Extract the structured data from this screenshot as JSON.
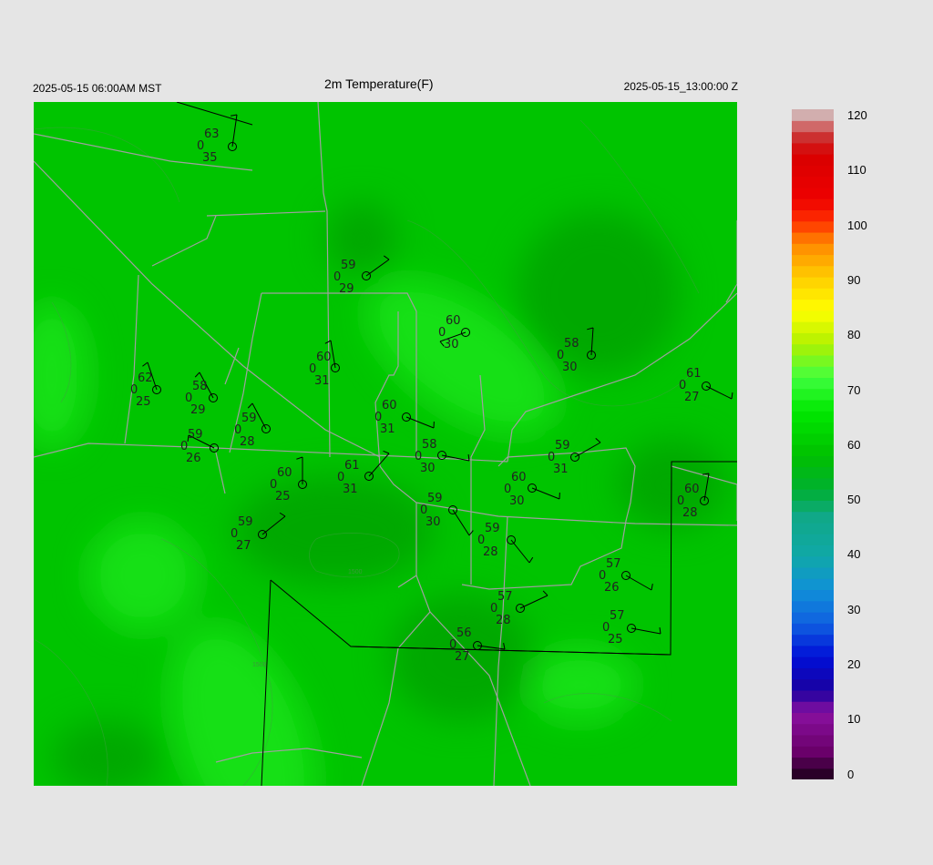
{
  "header": {
    "local_time": "2025-05-15 06:00AM MST",
    "title": "2m Temperature(F)",
    "utc_time": "2025-05-15_13:00:00 Z"
  },
  "colorbar": {
    "labels": [
      "120",
      "110",
      "100",
      "90",
      "80",
      "70",
      "60",
      "50",
      "40",
      "30",
      "20",
      "10",
      "0"
    ],
    "min": 0,
    "max": 120,
    "stops": [
      {
        "v": 0,
        "c": "#1a0018"
      },
      {
        "v": 5,
        "c": "#6a006a"
      },
      {
        "v": 12,
        "c": "#8a10a0"
      },
      {
        "v": 16,
        "c": "#1a00a0"
      },
      {
        "v": 22,
        "c": "#0010d8"
      },
      {
        "v": 28,
        "c": "#1060e0"
      },
      {
        "v": 34,
        "c": "#1090d8"
      },
      {
        "v": 40,
        "c": "#10a8a8"
      },
      {
        "v": 47,
        "c": "#10a888"
      },
      {
        "v": 52,
        "c": "#00b030"
      },
      {
        "v": 58,
        "c": "#00c000"
      },
      {
        "v": 66,
        "c": "#00e800"
      },
      {
        "v": 72,
        "c": "#40ff40"
      },
      {
        "v": 78,
        "c": "#b0f000"
      },
      {
        "v": 84,
        "c": "#ffff00"
      },
      {
        "v": 90,
        "c": "#ffcc00"
      },
      {
        "v": 96,
        "c": "#ff8800"
      },
      {
        "v": 100,
        "c": "#ff3000"
      },
      {
        "v": 104,
        "c": "#ee0000"
      },
      {
        "v": 112,
        "c": "#d80000"
      },
      {
        "v": 116,
        "c": "#c84040"
      },
      {
        "v": 118,
        "c": "#d89090"
      },
      {
        "v": 120,
        "c": "#cccccc"
      }
    ]
  },
  "map": {
    "fill_color": "#00c400",
    "light_color": "#12e012",
    "dark_color": "#00a800",
    "road_color": "#a0a0a0",
    "border_color": "#000000",
    "contour_labels": [
      "1500",
      "1500"
    ]
  },
  "stations": [
    {
      "temp": "63",
      "dew": "35",
      "mid": "0"
    },
    {
      "temp": "59",
      "dew": "29",
      "mid": "0"
    },
    {
      "temp": "60",
      "dew": "30",
      "mid": "0"
    },
    {
      "temp": "58",
      "dew": "30",
      "mid": "0"
    },
    {
      "temp": "60",
      "dew": "31",
      "mid": "0"
    },
    {
      "temp": "62",
      "dew": "25",
      "mid": "0"
    },
    {
      "temp": "58",
      "dew": "29",
      "mid": "0"
    },
    {
      "temp": "61",
      "dew": "27",
      "mid": "0"
    },
    {
      "temp": "60",
      "dew": "31",
      "mid": "0"
    },
    {
      "temp": "59",
      "dew": "28",
      "mid": "0"
    },
    {
      "temp": "59",
      "dew": "26",
      "mid": "0"
    },
    {
      "temp": "58",
      "dew": "30",
      "mid": "0"
    },
    {
      "temp": "59",
      "dew": "31",
      "mid": "0"
    },
    {
      "temp": "61",
      "dew": "31",
      "mid": "0"
    },
    {
      "temp": "60",
      "dew": "25",
      "mid": "0"
    },
    {
      "temp": "60",
      "dew": "30",
      "mid": "0"
    },
    {
      "temp": "60",
      "dew": "28",
      "mid": "0"
    },
    {
      "temp": "59",
      "dew": "30",
      "mid": "0"
    },
    {
      "temp": "59",
      "dew": "27",
      "mid": "0"
    },
    {
      "temp": "59",
      "dew": "28",
      "mid": "0"
    },
    {
      "temp": "57",
      "dew": "26",
      "mid": "0"
    },
    {
      "temp": "57",
      "dew": "28",
      "mid": "0"
    },
    {
      "temp": "57",
      "dew": "25",
      "mid": "0"
    },
    {
      "temp": "56",
      "dew": "27",
      "mid": "0"
    }
  ]
}
